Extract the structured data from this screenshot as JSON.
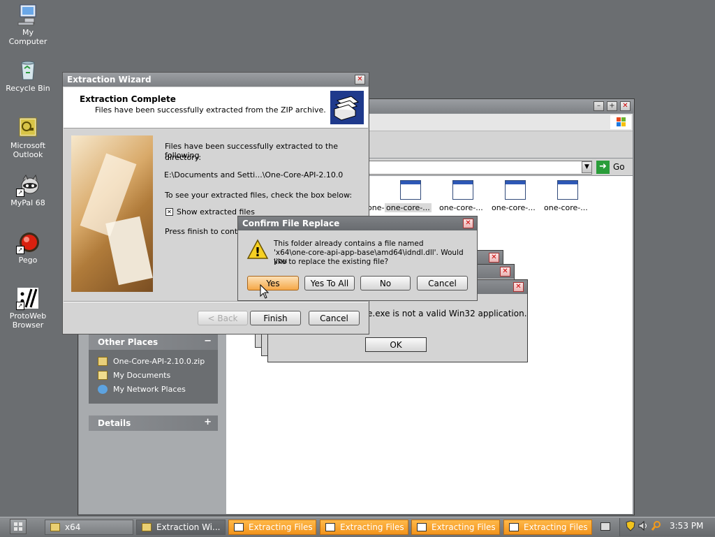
{
  "desktop": {
    "icons": [
      {
        "label1": "My",
        "label2": "Computer"
      },
      {
        "label1": "Recycle Bin",
        "label2": ""
      },
      {
        "label1": "Microsoft",
        "label2": "Outlook"
      },
      {
        "label1": "MyPal 68",
        "label2": ""
      },
      {
        "label1": "Pego",
        "label2": ""
      },
      {
        "label1": "ProtoWeb",
        "label2": "Browser"
      }
    ]
  },
  "explorer": {
    "go_label": "Go",
    "files": [
      "one-core-...",
      "one-core-...",
      "one-core-...",
      "one-core-...",
      "one-core-..."
    ],
    "other_places": {
      "title": "Other Places",
      "collapse": "−",
      "items": [
        "One-Core-API-2.10.0.zip",
        "My Documents",
        "My Network Places"
      ]
    },
    "details": {
      "title": "Details",
      "expand": "+"
    }
  },
  "error_dialog": {
    "message": "e.exe is not a valid Win32 application.",
    "ok_label": "OK"
  },
  "wizard": {
    "title": "Extraction Wizard",
    "header_title": "Extraction Complete",
    "header_subtitle": "Files have been successfully extracted from the ZIP archive.",
    "line1": "Files have been successfully extracted to the following",
    "line2": "directory:",
    "path": "E:\\Documents and Setti...\\One-Core-API-2.10.0",
    "check_prompt": "To see your extracted files, check the box below:",
    "checkbox_label": "Show extracted files",
    "checkbox_mark": "✕",
    "finish_prompt": "Press finish to continu",
    "back_label": "< Back",
    "finish_label": "Finish",
    "cancel_label": "Cancel"
  },
  "confirm": {
    "title": "Confirm File Replace",
    "line1": "This folder already contains a file named",
    "line2": "'x64\\one-core-api-app-base\\amd64\\idndl.dll'.  Would you",
    "line3": "like to replace the existing file?",
    "yes_label": "Yes",
    "yes_all_label": "Yes To All",
    "no_label": "No",
    "cancel_label": "Cancel",
    "warning_glyph": "!"
  },
  "taskbar": {
    "buttons": [
      {
        "label": "x64"
      },
      {
        "label": "Extraction Wi..."
      },
      {
        "label": "Extracting Files"
      },
      {
        "label": "Extracting Files"
      },
      {
        "label": "Extracting Files"
      },
      {
        "label": "Extracting Files"
      }
    ],
    "clock": "3:53 PM"
  },
  "colors": {
    "desktop_bg": "#6b6e71",
    "task_orange": "#f2931b",
    "titlebar_gray": "#7e8185"
  }
}
